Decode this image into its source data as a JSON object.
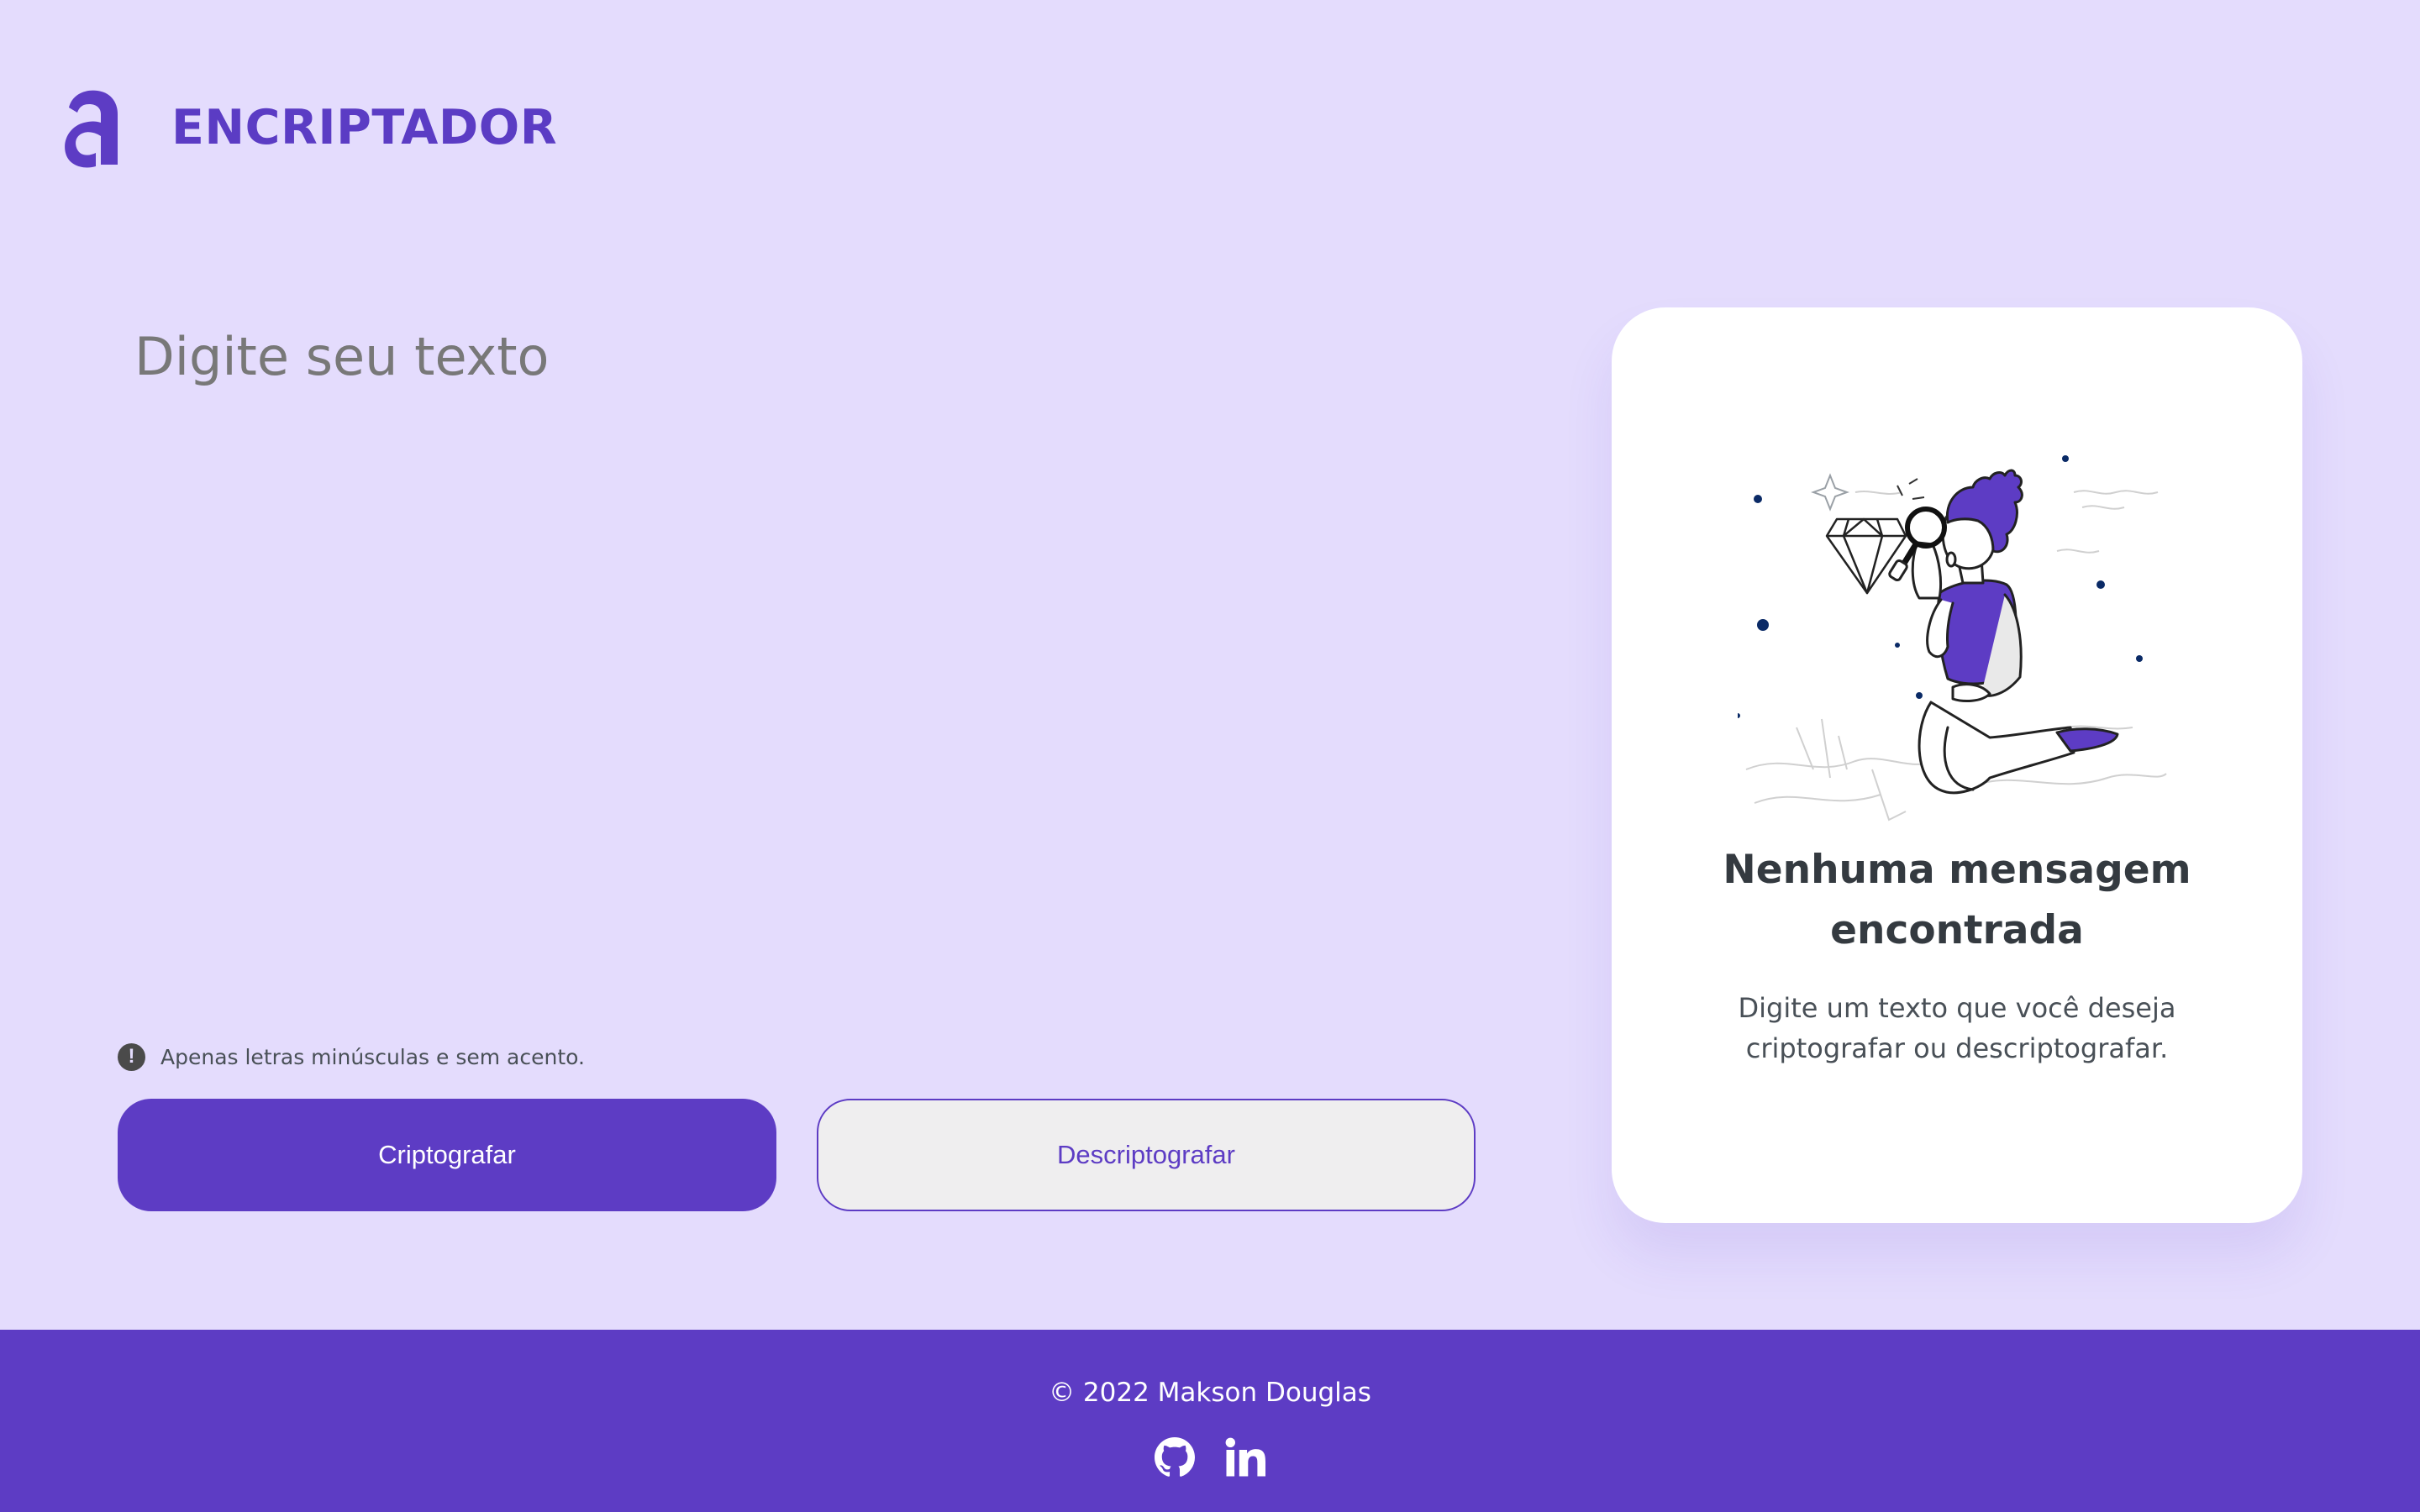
{
  "header": {
    "logo_icon": "alura-a-logo-icon",
    "brand": "ENCRIPTADOR"
  },
  "editor": {
    "placeholder": "Digite seu texto",
    "value": ""
  },
  "hint": {
    "icon": "exclamation-circle-icon",
    "text": "Apenas letras minúsculas e sem acento."
  },
  "buttons": {
    "encrypt": "Criptografar",
    "decrypt": "Descriptografar"
  },
  "result": {
    "illustration_icon": "person-magnifier-diamond-illustration",
    "title": "Nenhuma mensagem encontrada",
    "text": "Digite um texto que você deseja criptografar ou descriptografar."
  },
  "footer": {
    "copyright": "© 2022 Makson Douglas",
    "links": [
      {
        "icon": "github-icon"
      },
      {
        "icon": "linkedin-icon"
      }
    ]
  },
  "colors": {
    "background": "#e4dcfd",
    "accent": "#5d3cc4",
    "card": "#ffffff",
    "title_text": "#343a40"
  }
}
